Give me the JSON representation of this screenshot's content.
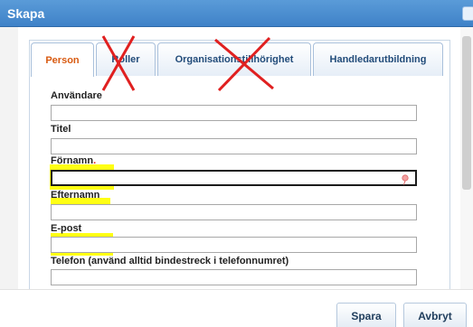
{
  "dialog": {
    "title": "Skapa"
  },
  "tabs": [
    {
      "label": "Person",
      "active": true,
      "crossed_out": false
    },
    {
      "label": "Roller",
      "active": false,
      "crossed_out": true
    },
    {
      "label": "Organisationstillhörighet",
      "active": false,
      "crossed_out": true
    },
    {
      "label": "Handledarutbildning",
      "active": false,
      "crossed_out": false
    }
  ],
  "fields": [
    {
      "label": "Användare",
      "value": "",
      "required": false,
      "highlighted": false
    },
    {
      "label": "Titel",
      "value": "",
      "required": false,
      "highlighted": false
    },
    {
      "label": "Förnamn",
      "required_marker": ".",
      "value": "",
      "required": true,
      "focused": true,
      "highlighted": true
    },
    {
      "label": "Efternamn",
      "value": "",
      "required": false,
      "highlighted": true
    },
    {
      "label": "E-post",
      "value": "",
      "required": false,
      "highlighted": true
    },
    {
      "label": "Telefon (använd alltid bindestreck i telefonnumret)",
      "value": "",
      "required": false,
      "highlighted": false
    }
  ],
  "buttons": {
    "save": "Spara",
    "cancel": "Avbryt"
  },
  "colors": {
    "titlebar": "#4a8fd2",
    "active_tab_text": "#d85a10",
    "highlight": "#ffff00",
    "cross": "#e02020"
  },
  "icons": {
    "focused_field": "pin-icon",
    "title_close": "close-icon"
  }
}
